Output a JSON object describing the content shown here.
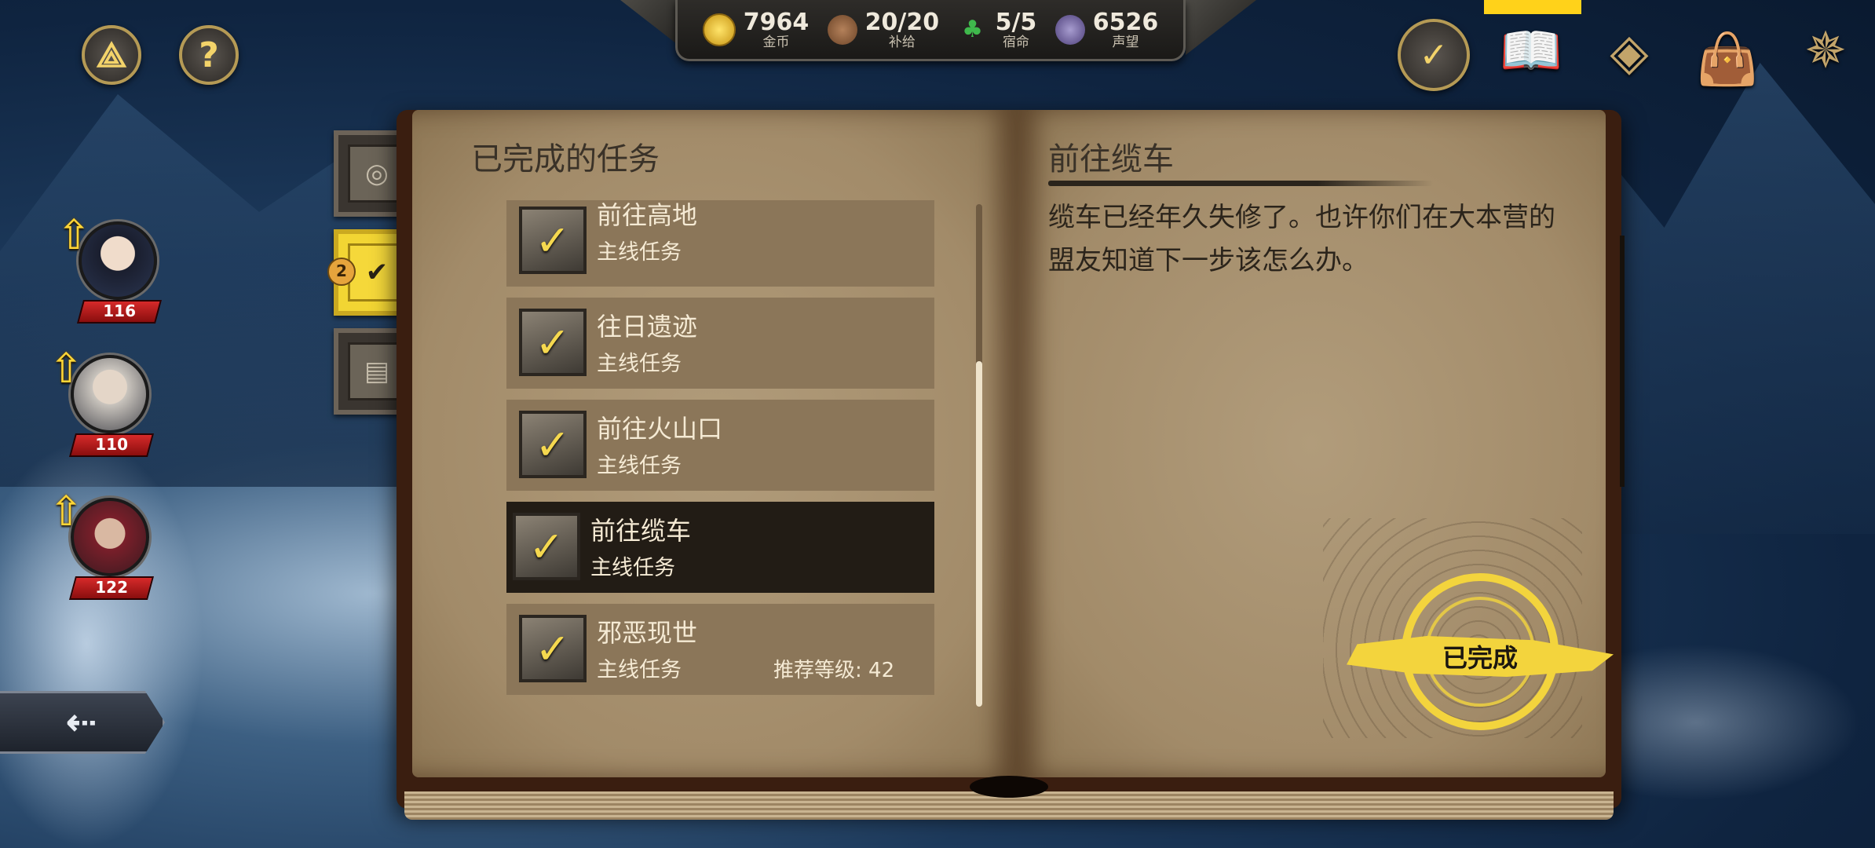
{
  "resources": [
    {
      "icon": "gold-coin-icon",
      "value": "7964",
      "label": "金币"
    },
    {
      "icon": "supply-bag-icon",
      "value": "20/20",
      "label": "补给"
    },
    {
      "icon": "clover-icon",
      "value": "5/5",
      "label": "宿命"
    },
    {
      "icon": "reputation-gem-icon",
      "value": "6526",
      "label": "声望"
    }
  ],
  "heroes": [
    {
      "level": "116"
    },
    {
      "level": "110"
    },
    {
      "level": "122"
    }
  ],
  "left_page": {
    "title": "已完成的任务",
    "quests": [
      {
        "name": "前往高地",
        "type": "主线任务",
        "recommend": ""
      },
      {
        "name": "往日遗迹",
        "type": "主线任务",
        "recommend": ""
      },
      {
        "name": "前往火山口",
        "type": "主线任务",
        "recommend": ""
      },
      {
        "name": "前往缆车",
        "type": "主线任务",
        "recommend": "",
        "selected": true
      },
      {
        "name": "邪恶现世",
        "type": "主线任务",
        "recommend": "推荐等级: 42"
      }
    ]
  },
  "right_page": {
    "title": "前往缆车",
    "description": "缆车已经年久失修了。也许你们在大本营的盟友知道下一步该怎么办。",
    "status": "已完成"
  },
  "tabs": {
    "badge": "2"
  },
  "colors": {
    "accent_yellow": "#f3d43d",
    "level_red": "#d62a2a",
    "page_tan": "#a28b69"
  }
}
